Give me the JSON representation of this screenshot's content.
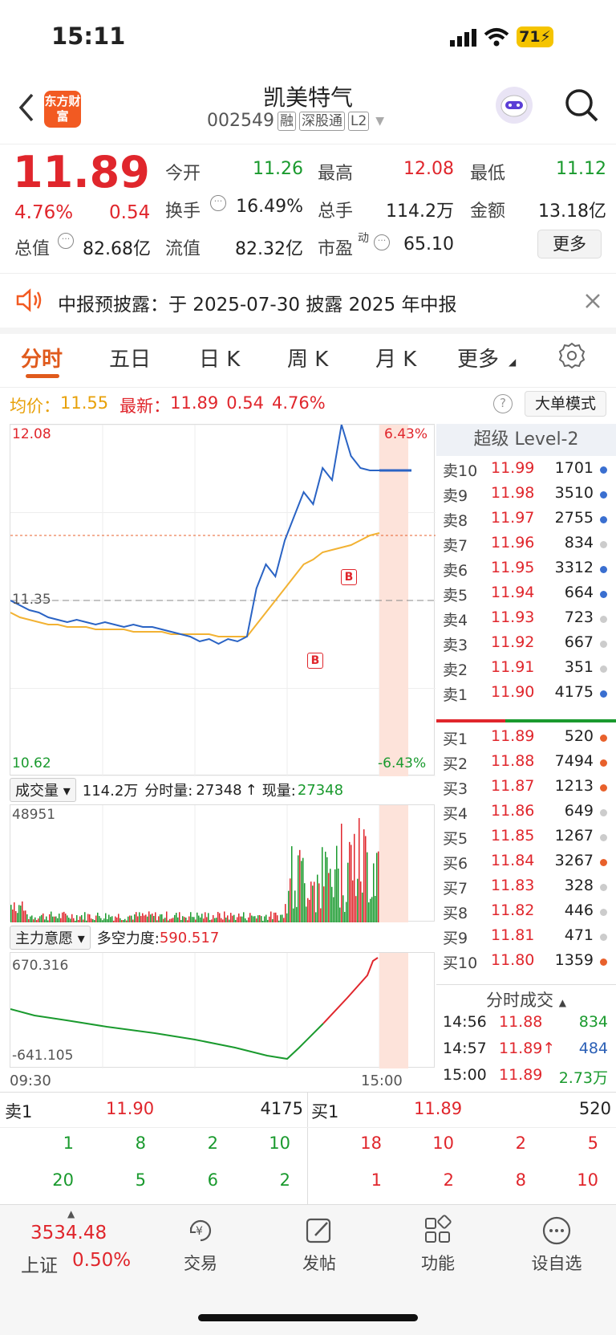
{
  "status": {
    "time": "15:11",
    "battery": "71"
  },
  "header": {
    "name": "凯美特气",
    "code": "002549",
    "tags": [
      "融",
      "深股通",
      "L2"
    ],
    "logo": "东方财富"
  },
  "quote": {
    "price": "11.89",
    "pct": "4.76%",
    "chg": "0.54",
    "items": [
      {
        "label": "今开",
        "value": "11.26",
        "color": "green"
      },
      {
        "label": "最高",
        "value": "12.08",
        "color": "red"
      },
      {
        "label": "最低",
        "value": "11.12",
        "color": "green"
      },
      {
        "label": "换手",
        "value": "16.49%",
        "color": "black"
      },
      {
        "label": "总手",
        "value": "114.2万",
        "color": "black"
      },
      {
        "label": "金额",
        "value": "13.18亿",
        "color": "black"
      },
      {
        "label": "总值",
        "value": "82.68亿",
        "color": "black"
      },
      {
        "label": "流值",
        "value": "82.32亿",
        "color": "black"
      },
      {
        "label": "市盈",
        "value": "65.10",
        "color": "black"
      }
    ],
    "pe_sup": "动",
    "more": "更多"
  },
  "notice": {
    "text": "中报预披露：于 2025-07-30 披露 2025 年中报"
  },
  "tabs": [
    "分时",
    "五日",
    "日 K",
    "周 K",
    "月 K",
    "更多"
  ],
  "infobar": {
    "avg_label": "均价：",
    "avg": "11.55",
    "last_label": "最新：",
    "last": "11.89",
    "chg": "0.54",
    "pct": "4.76%",
    "mode_btn": "大单模式"
  },
  "chart_data": {
    "type": "line",
    "title": "",
    "x_start": "09:30",
    "x_end": "15:00",
    "y_high": "12.08",
    "y_low": "10.62",
    "y_mid": "11.35",
    "pct_high": "6.43%",
    "pct_low": "-6.43%",
    "ylim": [
      10.62,
      12.08
    ],
    "price": [
      11.35,
      11.33,
      11.31,
      11.3,
      11.28,
      11.27,
      11.26,
      11.27,
      11.26,
      11.25,
      11.26,
      11.25,
      11.24,
      11.25,
      11.24,
      11.24,
      11.23,
      11.22,
      11.21,
      11.2,
      11.18,
      11.19,
      11.17,
      11.19,
      11.18,
      11.2,
      11.4,
      11.5,
      11.45,
      11.6,
      11.7,
      11.8,
      11.75,
      11.9,
      11.85,
      12.08,
      11.95,
      11.9,
      11.89,
      11.89
    ],
    "avg": [
      11.3,
      11.28,
      11.27,
      11.26,
      11.25,
      11.25,
      11.24,
      11.24,
      11.24,
      11.23,
      11.23,
      11.23,
      11.23,
      11.22,
      11.22,
      11.22,
      11.22,
      11.21,
      11.21,
      11.21,
      11.21,
      11.21,
      11.2,
      11.2,
      11.2,
      11.2,
      11.25,
      11.3,
      11.35,
      11.4,
      11.45,
      11.5,
      11.52,
      11.55,
      11.56,
      11.57,
      11.58,
      11.6,
      11.62,
      11.63
    ],
    "marker_b": "B",
    "marker_r": "B"
  },
  "volume": {
    "label": "成交量",
    "total": "114.2万",
    "fen_label": "分时量:",
    "fen": "27348",
    "arrow": "↑",
    "now_label": "现量:",
    "now": "27348",
    "max": "48951"
  },
  "flow": {
    "label": "主力意愿",
    "power_label": "多空力度:",
    "power": "590.517",
    "max": "670.316",
    "min": "-641.105",
    "t0": "09:30",
    "t1": "15:00"
  },
  "level2": {
    "title": "超级 Level-2",
    "asks": [
      [
        "卖10",
        "11.99",
        "1701"
      ],
      [
        "卖9",
        "11.98",
        "3510"
      ],
      [
        "卖8",
        "11.97",
        "2755"
      ],
      [
        "卖7",
        "11.96",
        "834"
      ],
      [
        "卖6",
        "11.95",
        "3312"
      ],
      [
        "卖5",
        "11.94",
        "664"
      ],
      [
        "卖4",
        "11.93",
        "723"
      ],
      [
        "卖3",
        "11.92",
        "667"
      ],
      [
        "卖2",
        "11.91",
        "351"
      ],
      [
        "卖1",
        "11.90",
        "4175"
      ]
    ],
    "bids": [
      [
        "买1",
        "11.89",
        "520"
      ],
      [
        "买2",
        "11.88",
        "7494"
      ],
      [
        "买3",
        "11.87",
        "1213"
      ],
      [
        "买4",
        "11.86",
        "649"
      ],
      [
        "买5",
        "11.85",
        "1267"
      ],
      [
        "买6",
        "11.84",
        "3267"
      ],
      [
        "买7",
        "11.83",
        "328"
      ],
      [
        "买8",
        "11.82",
        "446"
      ],
      [
        "买9",
        "11.81",
        "471"
      ],
      [
        "买10",
        "11.80",
        "1359"
      ]
    ],
    "trades_title": "分时成交",
    "trades": [
      [
        "14:56",
        "11.88",
        "834"
      ],
      [
        "14:57",
        "11.89↑",
        "484"
      ],
      [
        "15:00",
        "11.89",
        "2.73万"
      ]
    ]
  },
  "queue": {
    "sell_label": "卖1",
    "sell_price": "11.90",
    "sell_vol": "4175",
    "buy_label": "买1",
    "buy_price": "11.89",
    "buy_vol": "520",
    "sell_rows": [
      [
        "1",
        "8",
        "2",
        "10"
      ],
      [
        "20",
        "5",
        "6",
        "2"
      ]
    ],
    "buy_rows": [
      [
        "18",
        "10",
        "2",
        "5"
      ],
      [
        "1",
        "2",
        "8",
        "10"
      ]
    ]
  },
  "nav": {
    "index_value": "3534.48",
    "index_name": "上证",
    "index_pct": "0.50%",
    "items": [
      "交易",
      "发帖",
      "功能",
      "设自选"
    ]
  }
}
